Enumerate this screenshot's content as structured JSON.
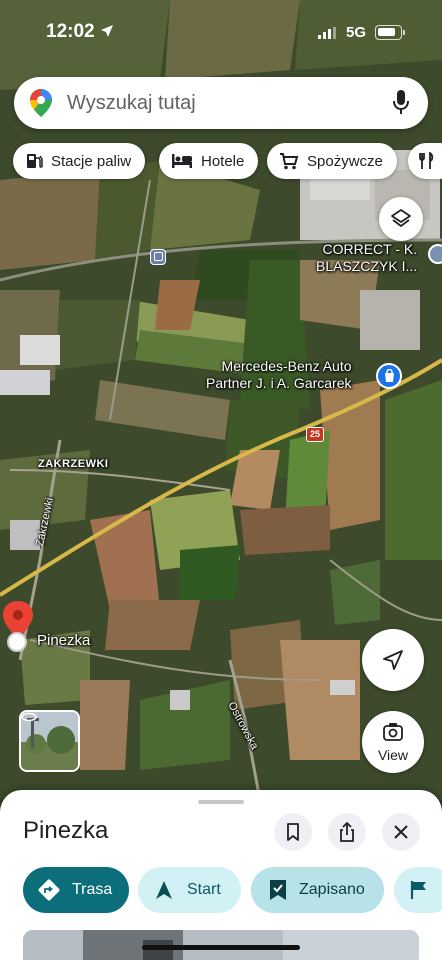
{
  "status_bar": {
    "time": "12:02",
    "network": "5G",
    "battery_level": 0.85
  },
  "search": {
    "placeholder": "Wyszukaj tutaj",
    "logo": "google-maps-pin-icon",
    "mic_icon": "microphone-icon"
  },
  "chips": [
    {
      "label": "Stacje paliw",
      "icon": "fuel-pump-icon"
    },
    {
      "label": "Hotele",
      "icon": "bed-icon"
    },
    {
      "label": "Spożywcze",
      "icon": "shopping-cart-icon"
    },
    {
      "label": "",
      "icon": "fork-knife-icon"
    }
  ],
  "map": {
    "pois": [
      {
        "label": "CORRECT - K.\nBLASZCZYK I..."
      },
      {
        "label": "Mercedes-Benz Auto\nPartner J. i A. Garcarek",
        "icon": "shopping-bag-icon"
      }
    ],
    "village": "ZAKRZEWKI",
    "roads": [
      {
        "label": "Zakrzewki"
      },
      {
        "label": "Ostrowska"
      }
    ],
    "road_shield": "25",
    "pin_label": "Pinezka",
    "colors": {
      "pin": "#ea4335",
      "poi_blue": "#1a73e8",
      "road_shield": "#c8361f"
    }
  },
  "buttons": {
    "view_label": "View",
    "layers_icon": "layers-icon",
    "locate_icon": "navigation-arrow-icon"
  },
  "sheet": {
    "title": "Pinezka",
    "actions": [
      {
        "label": "Trasa",
        "icon": "directions-icon"
      },
      {
        "label": "Start",
        "icon": "navigation-icon"
      },
      {
        "label": "Zapisano",
        "icon": "bookmark-check-icon"
      },
      {
        "label": "",
        "icon": "flag-icon"
      }
    ],
    "colors": {
      "primary": "#0b6e7a",
      "tonal": "#d2f1f5",
      "saved": "#b7e2e8"
    }
  }
}
